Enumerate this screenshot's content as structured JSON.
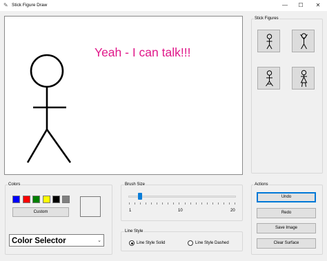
{
  "window": {
    "title": "Stick Figure Draw",
    "minimize_glyph": "—",
    "maximize_glyph": "☐",
    "close_glyph": "✕",
    "title_icon": "pencil-icon"
  },
  "canvas": {
    "speech_text": "Yeah - I can talk!!!",
    "speech_color": "#e0198a"
  },
  "stick_figures": {
    "label": "Stick Figures",
    "items": [
      "stick-figure-standing",
      "stick-figure-arms-raised",
      "stick-figure-walking",
      "stick-figure-skirt"
    ]
  },
  "colors": {
    "label": "Colors",
    "swatches": [
      "#0000ff",
      "#ff0000",
      "#008000",
      "#ffff00",
      "#000000",
      "#808080"
    ],
    "custom_button": "Custom",
    "selector_value": "Color Selector"
  },
  "brush_size": {
    "label": "Brush Size",
    "min": 1,
    "max": 20,
    "value": 3,
    "tick_labels": [
      "1",
      "10",
      "20"
    ]
  },
  "line_style": {
    "label": "Line Style",
    "options": [
      {
        "label": "Line Style Solid",
        "selected": true
      },
      {
        "label": "Line Style Dashed",
        "selected": false
      }
    ]
  },
  "actions": {
    "label": "Actions",
    "buttons": [
      "Undo",
      "Redo",
      "Save Image",
      "Clear Surface"
    ]
  }
}
